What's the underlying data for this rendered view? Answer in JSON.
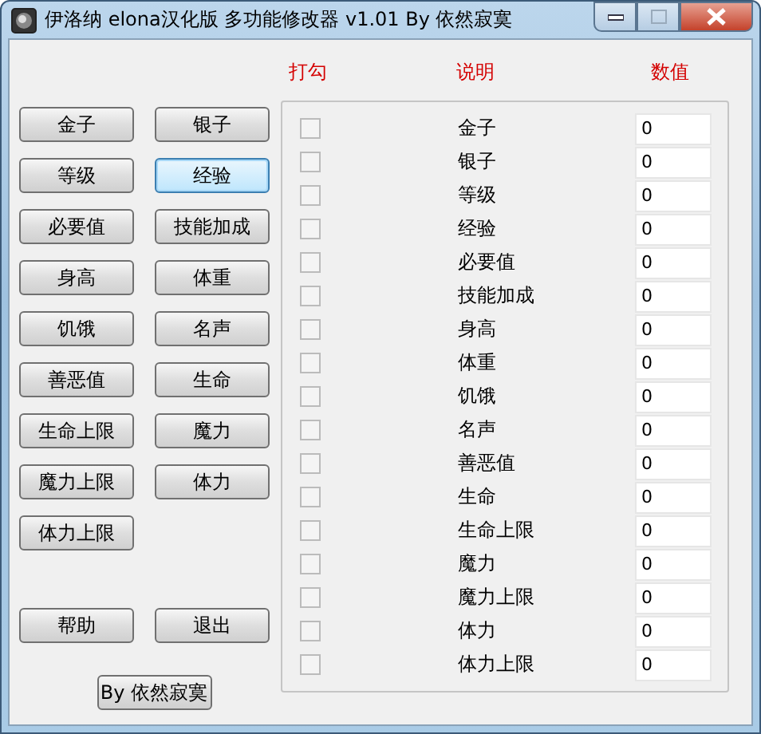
{
  "window": {
    "title": "伊洛纳 elona汉化版 多功能修改器 v1.01 By 依然寂寞"
  },
  "headers": [
    "打勾",
    "说明",
    "数值"
  ],
  "stat_buttons": [
    {
      "label": "金子",
      "focused": false
    },
    {
      "label": "银子",
      "focused": false
    },
    {
      "label": "等级",
      "focused": false
    },
    {
      "label": "经验",
      "focused": true
    },
    {
      "label": "必要值",
      "focused": false
    },
    {
      "label": "技能加成",
      "focused": false
    },
    {
      "label": "身高",
      "focused": false
    },
    {
      "label": "体重",
      "focused": false
    },
    {
      "label": "饥饿",
      "focused": false
    },
    {
      "label": "名声",
      "focused": false
    },
    {
      "label": "善恶值",
      "focused": false
    },
    {
      "label": "生命",
      "focused": false
    },
    {
      "label": "生命上限",
      "focused": false
    },
    {
      "label": "魔力",
      "focused": false
    },
    {
      "label": "魔力上限",
      "focused": false
    },
    {
      "label": "体力",
      "focused": false
    },
    {
      "label": "体力上限",
      "focused": false
    }
  ],
  "action_buttons": [
    "帮助",
    "退出"
  ],
  "credit_button": "By 依然寂寞",
  "rows": [
    {
      "checked": false,
      "label": "金子",
      "value": "0"
    },
    {
      "checked": false,
      "label": "银子",
      "value": "0"
    },
    {
      "checked": false,
      "label": "等级",
      "value": "0"
    },
    {
      "checked": false,
      "label": "经验",
      "value": "0"
    },
    {
      "checked": false,
      "label": "必要值",
      "value": "0"
    },
    {
      "checked": false,
      "label": "技能加成",
      "value": "0"
    },
    {
      "checked": false,
      "label": "身高",
      "value": "0"
    },
    {
      "checked": false,
      "label": "体重",
      "value": "0"
    },
    {
      "checked": false,
      "label": "饥饿",
      "value": "0"
    },
    {
      "checked": false,
      "label": "名声",
      "value": "0"
    },
    {
      "checked": false,
      "label": "善恶值",
      "value": "0"
    },
    {
      "checked": false,
      "label": "生命",
      "value": "0"
    },
    {
      "checked": false,
      "label": "生命上限",
      "value": "0"
    },
    {
      "checked": false,
      "label": "魔力",
      "value": "0"
    },
    {
      "checked": false,
      "label": "魔力上限",
      "value": "0"
    },
    {
      "checked": false,
      "label": "体力",
      "value": "0"
    },
    {
      "checked": false,
      "label": "体力上限",
      "value": "0"
    }
  ]
}
